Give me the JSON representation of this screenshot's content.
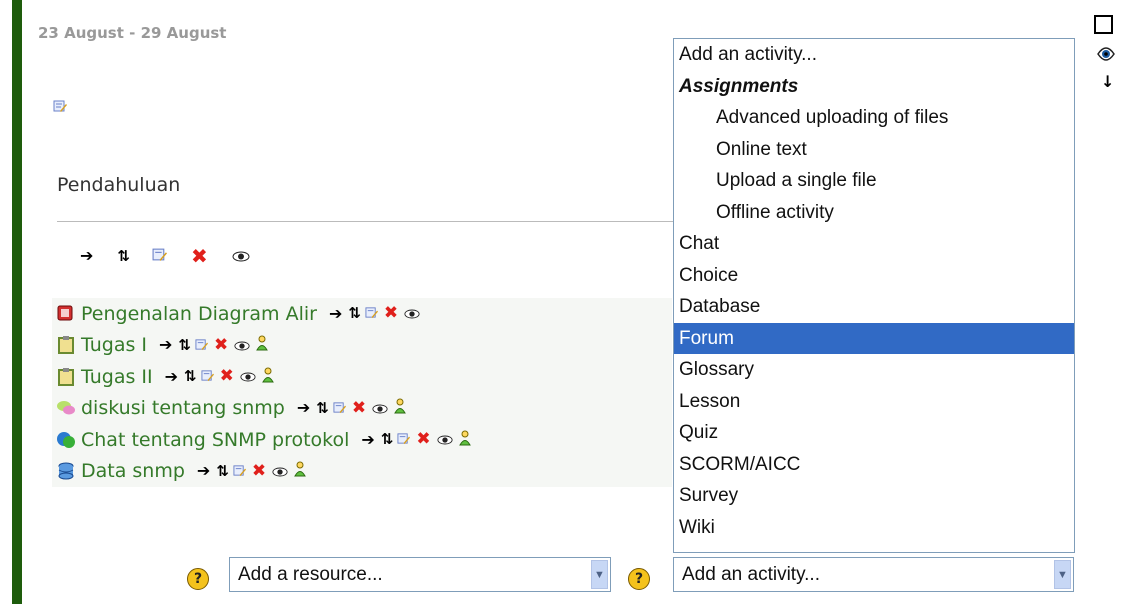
{
  "section": {
    "week_title": "23 August - 29 August",
    "name": "Pendahuluan"
  },
  "activities": [
    {
      "name": "Pengenalan Diagram Alir",
      "icon": "resource-icon",
      "group": false
    },
    {
      "name": "Tugas I",
      "icon": "assignment-icon",
      "group": true
    },
    {
      "name": "Tugas II",
      "icon": "assignment-icon",
      "group": true
    },
    {
      "name": "diskusi tentang snmp",
      "icon": "forum-icon",
      "group": true
    },
    {
      "name": "Chat tentang SNMP protokol",
      "icon": "chat-icon",
      "group": true
    },
    {
      "name": "Data snmp",
      "icon": "database-icon",
      "group": true
    }
  ],
  "add_resource": {
    "label": "Add a resource..."
  },
  "add_activity": {
    "label": "Add an activity...",
    "options": [
      {
        "label": "Add an activity...",
        "kind": "item"
      },
      {
        "label": "Assignments",
        "kind": "group"
      },
      {
        "label": "Advanced uploading of files",
        "kind": "sub"
      },
      {
        "label": "Online text",
        "kind": "sub"
      },
      {
        "label": "Upload a single file",
        "kind": "sub"
      },
      {
        "label": "Offline activity",
        "kind": "sub"
      },
      {
        "label": "Chat",
        "kind": "item"
      },
      {
        "label": "Choice",
        "kind": "item"
      },
      {
        "label": "Database",
        "kind": "item"
      },
      {
        "label": "Forum",
        "kind": "item",
        "selected": true
      },
      {
        "label": "Glossary",
        "kind": "item"
      },
      {
        "label": "Lesson",
        "kind": "item"
      },
      {
        "label": "Quiz",
        "kind": "item"
      },
      {
        "label": "SCORM/AICC",
        "kind": "item"
      },
      {
        "label": "Survey",
        "kind": "item"
      },
      {
        "label": "Wiki",
        "kind": "item"
      }
    ]
  },
  "help_glyph": "?",
  "colors": {
    "section_bar": "#1e5c0c",
    "link": "#357a2a",
    "selected": "#316ac5"
  }
}
